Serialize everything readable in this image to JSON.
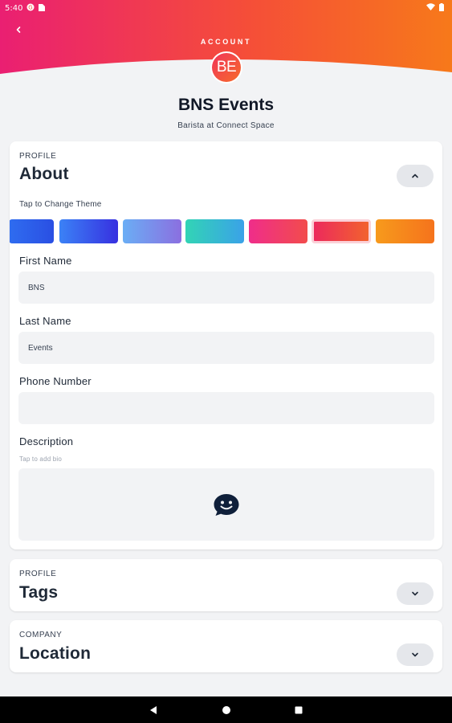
{
  "status_bar": {
    "time": "5:40"
  },
  "header": {
    "section_label": "ACCOUNT",
    "avatar_initials": "BE",
    "colors": {
      "gradient_start": "#ea1f72",
      "gradient_mid": "#f54e38",
      "gradient_end": "#f7791a"
    }
  },
  "profile": {
    "name": "BNS Events",
    "subtitle": "Barista at Connect Space"
  },
  "about_card": {
    "eyebrow": "PROFILE",
    "heading": "About",
    "theme_label": "Tap to Change Theme",
    "themes": [
      {
        "name": "blue",
        "from": "#2f6df0",
        "to": "#2a4fe3",
        "selected": false
      },
      {
        "name": "indigo",
        "from": "#3b82f6",
        "to": "#3730e0",
        "selected": false
      },
      {
        "name": "sky-violet",
        "from": "#6aaef5",
        "to": "#8b6fe0",
        "selected": false
      },
      {
        "name": "teal",
        "from": "#32d4b5",
        "to": "#3aa2e8",
        "selected": false
      },
      {
        "name": "pink",
        "from": "#ef2d8a",
        "to": "#f24c4c",
        "selected": false
      },
      {
        "name": "coral",
        "from": "#ec2a5c",
        "to": "#f2622e",
        "selected": true
      },
      {
        "name": "orange",
        "from": "#f79a1c",
        "to": "#f5731c",
        "selected": false
      }
    ],
    "fields": {
      "first_name": {
        "label": "First Name",
        "value": "BNS"
      },
      "last_name": {
        "label": "Last Name",
        "value": "Events"
      },
      "phone": {
        "label": "Phone Number",
        "value": ""
      },
      "description": {
        "label": "Description",
        "hint": "Tap to add bio"
      }
    }
  },
  "tags_card": {
    "eyebrow": "PROFILE",
    "heading": "Tags"
  },
  "location_card": {
    "eyebrow": "COMPANY",
    "heading": "Location"
  }
}
